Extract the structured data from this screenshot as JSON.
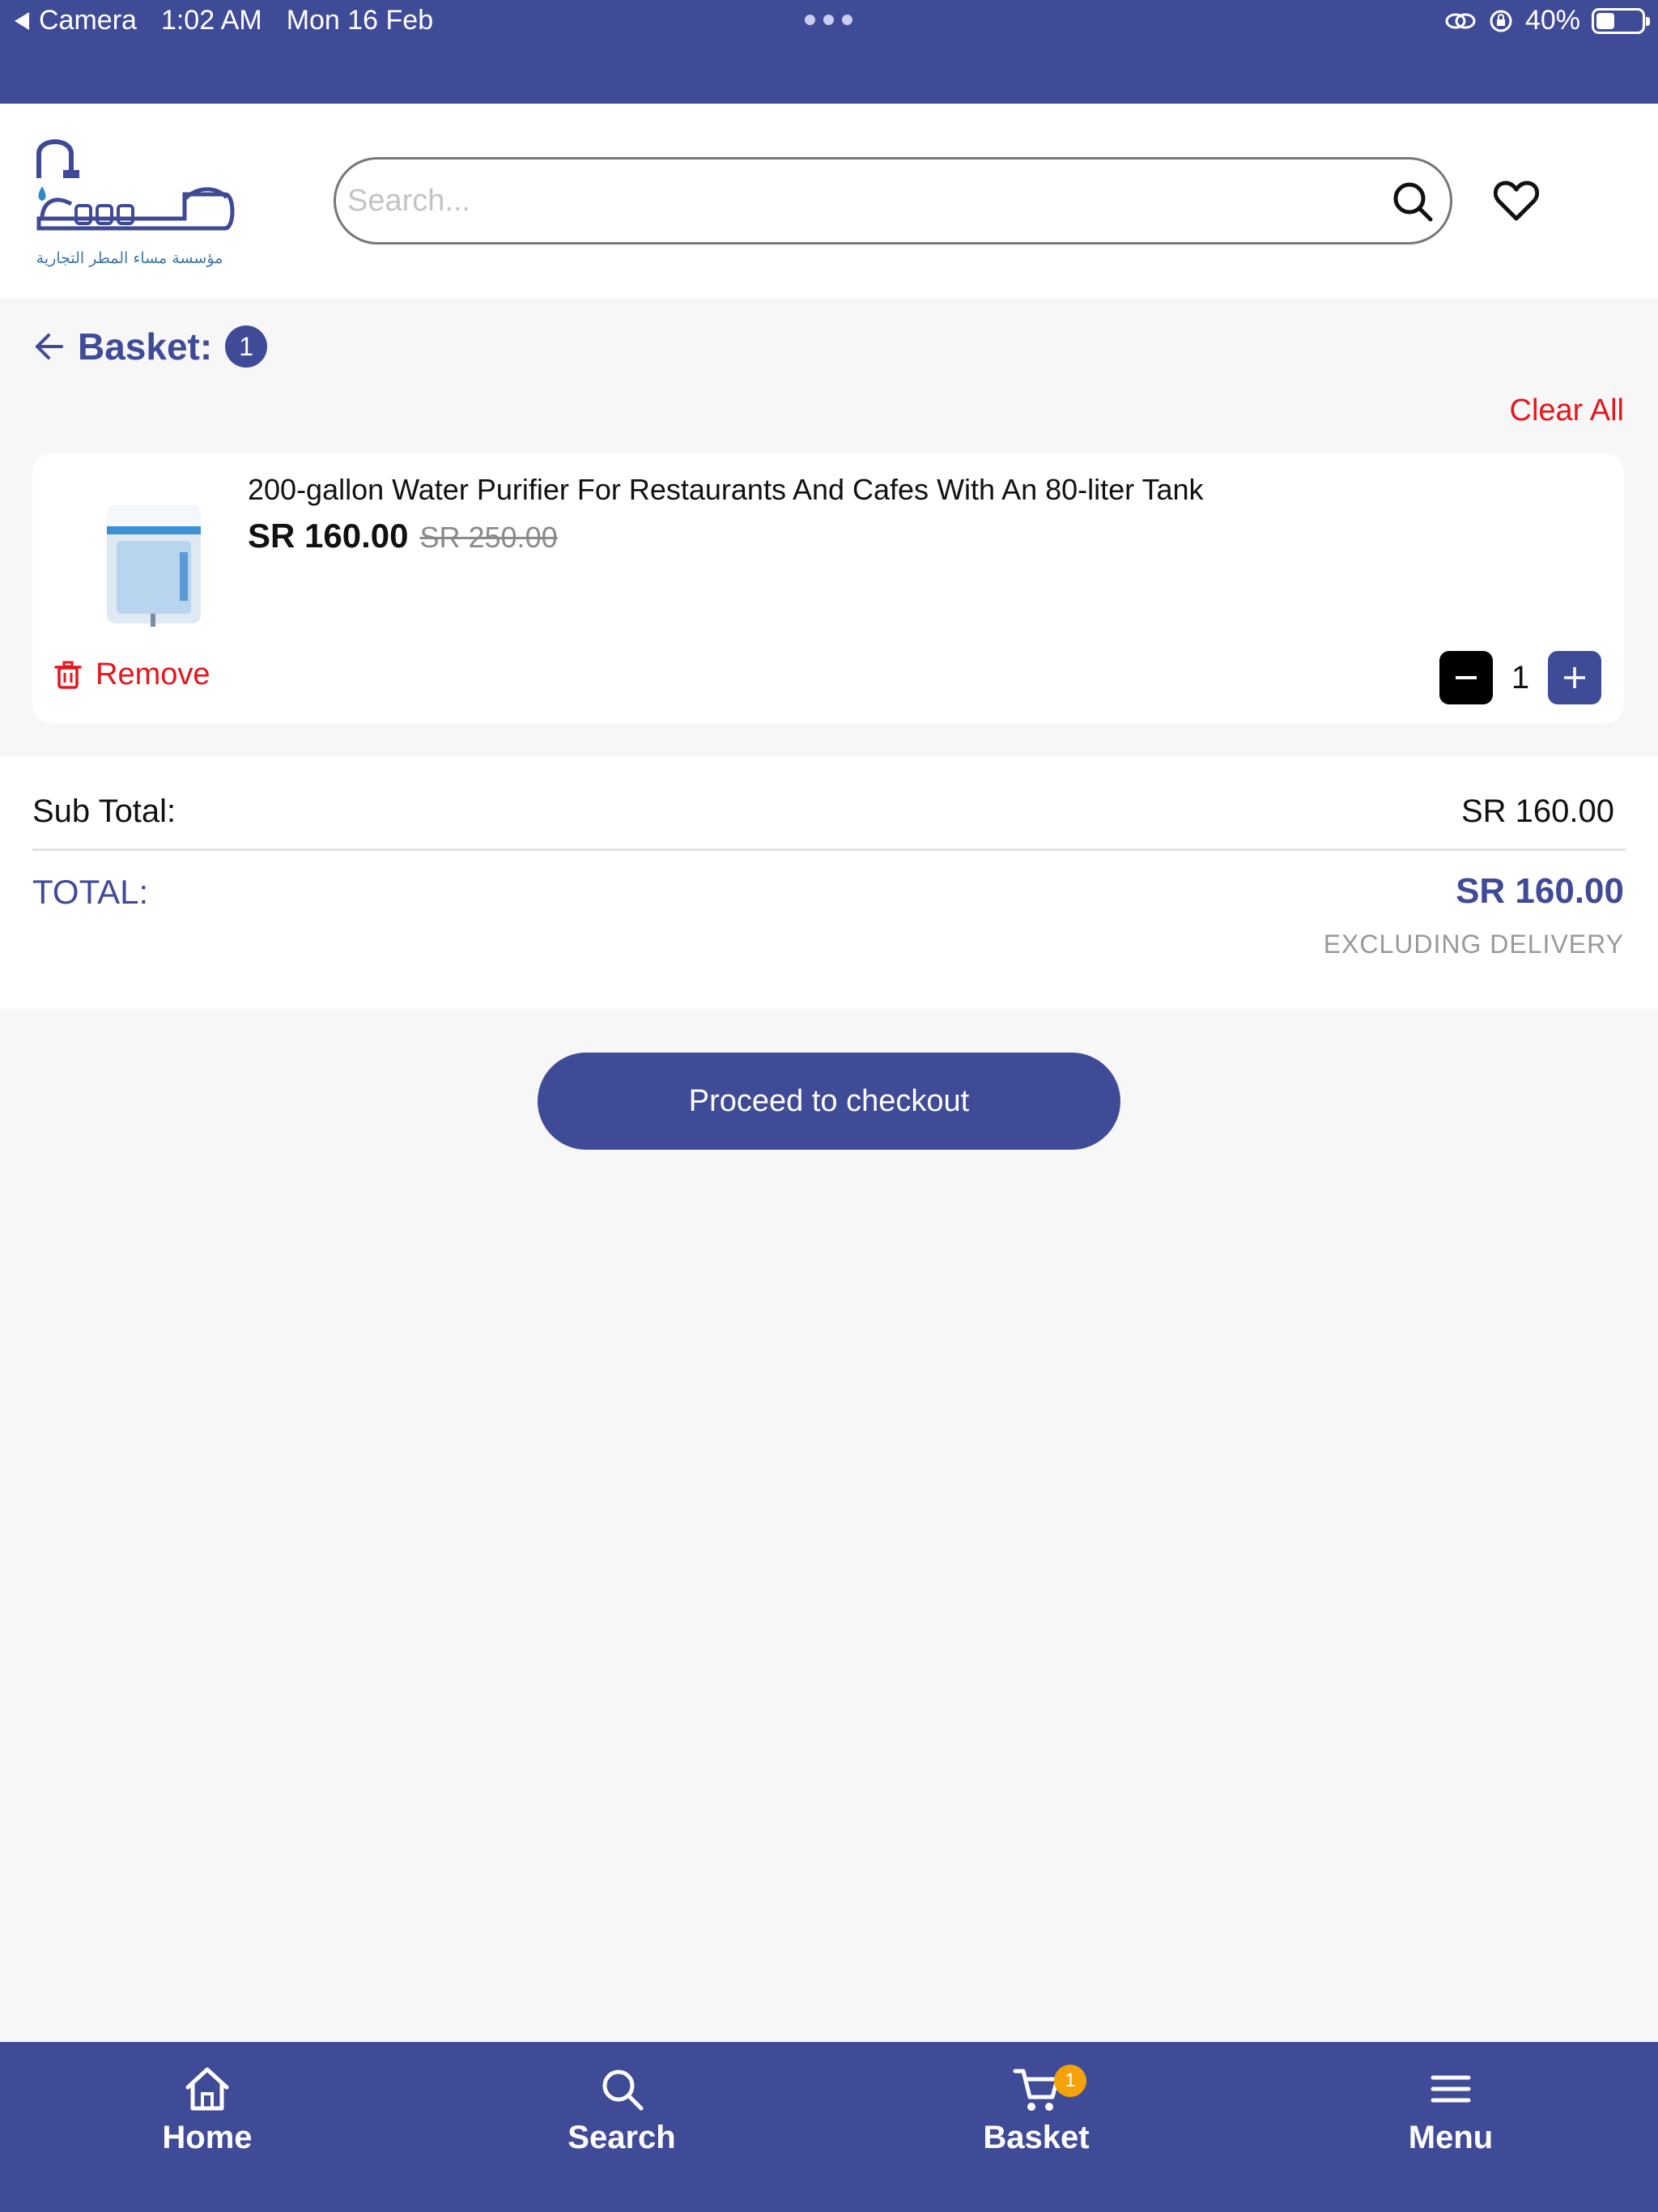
{
  "status_bar": {
    "back_app": "Camera",
    "time": "1:02 AM",
    "date": "Mon 16 Feb",
    "battery": "40%"
  },
  "header": {
    "logo_caption": "مؤسسة مساء المطر التجارية",
    "search_placeholder": "Search...",
    "icons": {
      "search": "search-icon",
      "wishlist": "heart-icon"
    }
  },
  "basket": {
    "title": "Basket:",
    "count": "1",
    "clear_all": "Clear All",
    "items": [
      {
        "name": "200-gallon Water Purifier For Restaurants And Cafes With An 80-liter Tank",
        "price": "SR 160.00",
        "old_price": "SR 250.00",
        "remove_label": "Remove",
        "quantity": "1"
      }
    ]
  },
  "totals": {
    "subtotal_label": "Sub Total:",
    "subtotal_value": "SR 160.00",
    "total_label": "TOTAL:",
    "total_value": "SR 160.00",
    "note": "EXCLUDING DELIVERY"
  },
  "checkout_label": "Proceed to checkout",
  "bottom_nav": {
    "items": [
      {
        "label": "Home",
        "icon": "home-icon"
      },
      {
        "label": "Search",
        "icon": "search-icon"
      },
      {
        "label": "Basket",
        "icon": "cart-icon",
        "badge": "1"
      },
      {
        "label": "Menu",
        "icon": "menu-icon"
      }
    ]
  },
  "colors": {
    "brand": "#404b98",
    "danger": "#e4161c",
    "badge": "#f5a20a",
    "background": "#f7f7f7"
  }
}
